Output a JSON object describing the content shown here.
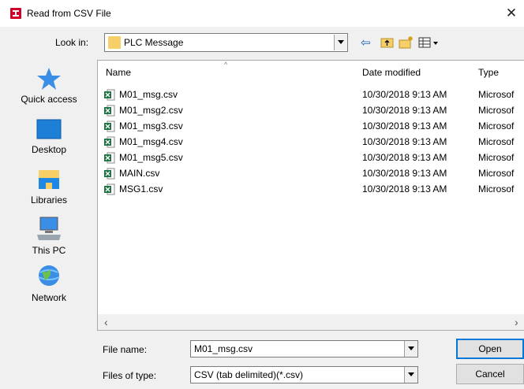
{
  "window": {
    "title": "Read from CSV File",
    "close_glyph": "✕"
  },
  "lookin": {
    "label": "Look in:",
    "value": "PLC Message"
  },
  "toolbar": {
    "back_glyph": "⇦"
  },
  "places": [
    {
      "label": "Quick access",
      "icon": "star-icon"
    },
    {
      "label": "Desktop",
      "icon": "desktop-icon"
    },
    {
      "label": "Libraries",
      "icon": "libraries-icon"
    },
    {
      "label": "This PC",
      "icon": "computer-icon"
    },
    {
      "label": "Network",
      "icon": "network-icon"
    }
  ],
  "columns": {
    "name": "Name",
    "date": "Date modified",
    "type": "Type"
  },
  "files": [
    {
      "name": "M01_msg.csv",
      "date": "10/30/2018 9:13 AM",
      "type": "Microsof"
    },
    {
      "name": "M01_msg2.csv",
      "date": "10/30/2018 9:13 AM",
      "type": "Microsof"
    },
    {
      "name": "M01_msg3.csv",
      "date": "10/30/2018 9:13 AM",
      "type": "Microsof"
    },
    {
      "name": "M01_msg4.csv",
      "date": "10/30/2018 9:13 AM",
      "type": "Microsof"
    },
    {
      "name": "M01_msg5.csv",
      "date": "10/30/2018 9:13 AM",
      "type": "Microsof"
    },
    {
      "name": "MAIN.csv",
      "date": "10/30/2018 9:13 AM",
      "type": "Microsof"
    },
    {
      "name": "MSG1.csv",
      "date": "10/30/2018 9:13 AM",
      "type": "Microsof"
    }
  ],
  "form": {
    "filename_label": "File name:",
    "filename_value": "M01_msg.csv",
    "filetype_label": "Files of type:",
    "filetype_value": "CSV (tab delimited)(*.csv)"
  },
  "buttons": {
    "open": "Open",
    "cancel": "Cancel"
  },
  "colors": {
    "accent": "#0078d7",
    "app_icon": "#d1002b",
    "excel": "#1f7244"
  }
}
